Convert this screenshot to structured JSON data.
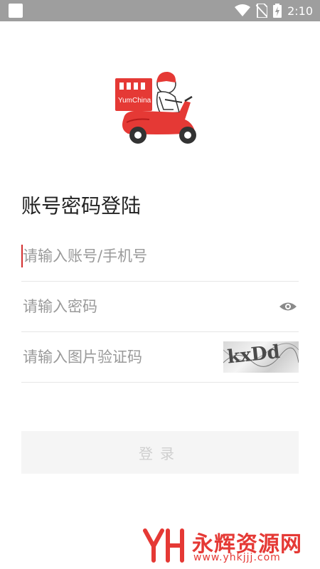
{
  "status_bar": {
    "time": "2:10",
    "icons": [
      "wifi-icon",
      "no-sim-icon",
      "battery-charging-icon"
    ]
  },
  "logo": {
    "text": "YumChina",
    "icon": "delivery-scooter-icon"
  },
  "page": {
    "title": "账号密码登陆"
  },
  "form": {
    "account_placeholder": "请输入账号/手机号",
    "password_placeholder": "请输入密码",
    "captcha_placeholder": "请输入图片验证码",
    "captcha_text": "kxDd",
    "password_toggle_icon": "eye-icon"
  },
  "login_button": {
    "label": "登录"
  },
  "watermark": {
    "name": "永辉资源网",
    "url": "www.yhkjjj.com"
  },
  "colors": {
    "accent": "#e53935",
    "status_bar": "#9e9e9e",
    "button_bg": "#f5f5f5",
    "button_text": "#cfcfcf"
  }
}
